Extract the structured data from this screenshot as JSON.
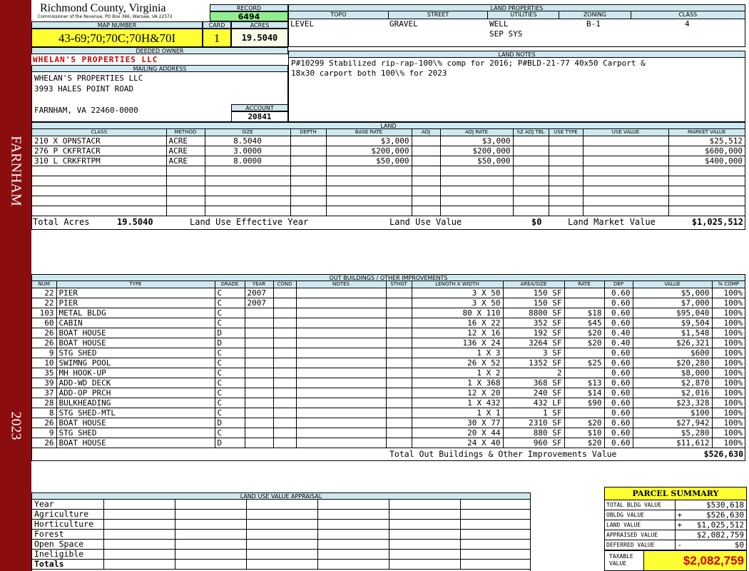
{
  "sidebar": {
    "city": "FARNHAM",
    "year": "2023"
  },
  "header": {
    "county": "Richmond County, Virginia",
    "commissioner": "Commissioner of the Revenue, PO Box 366, Warsaw, VA 22572",
    "record_label": "RECORD",
    "record": "6494",
    "map_number_label": "MAP NUMBER",
    "map_number": "43-69;70;70C;70H&70I",
    "card_label": "CARD",
    "card": "1",
    "acres_label": "ACRES",
    "acres": "19.5040"
  },
  "owner": {
    "deeded_owner_label": "DEEDED OWNER",
    "deeded_owner": "WHELAN'S PROPERTIES LLC",
    "mailing_address_label": "MAILING ADDRESS",
    "address_lines": [
      "WHELAN'S PROPERTIES LLC",
      "3993 HALES POINT ROAD",
      "",
      "FARNHAM, VA 22460-0000"
    ],
    "account_label": "ACCOUNT",
    "account": "20841"
  },
  "land_properties": {
    "label": "LAND PROPERTIES",
    "headers": [
      "TOPO",
      "STREET",
      "UTILITIES",
      "ZONING",
      "CLASS"
    ],
    "topo": "LEVEL",
    "street": "GRAVEL",
    "utilities": [
      "WELL",
      "SEP SYS"
    ],
    "zoning": "B-1",
    "class": "4"
  },
  "land_notes": {
    "label": "LAND NOTES",
    "lines": [
      "P#10299 Stabilized rip-rap-100\\% comp for 2016; P#BLD-21-77 40x50 Carport &",
      "18x30 carport both 100\\% for 2023"
    ]
  },
  "land": {
    "label": "LAND",
    "headers": [
      "CLASS",
      "METHOD",
      "SIZE",
      "DEPTH",
      "BASE RATE",
      "ADJ",
      "ADJ RATE",
      "SZ ADJ TBL",
      "USE TYPE",
      "USE VALUE",
      "MARKET VALUE"
    ],
    "rows": [
      {
        "class": "210 X OPNSTACR",
        "method": "ACRE",
        "size": "8.5040",
        "base_rate": "$3,000",
        "adj_rate": "$3,000",
        "market_value": "$25,512"
      },
      {
        "class": "276 P CKFRTACR",
        "method": "ACRE",
        "size": "3.0000",
        "base_rate": "$200,000",
        "adj_rate": "$200,000",
        "market_value": "$600,000"
      },
      {
        "class": "310 L CRKFRTPM",
        "method": "ACRE",
        "size": "8.0000",
        "base_rate": "$50,000",
        "adj_rate": "$50,000",
        "market_value": "$400,000"
      }
    ],
    "total_acres_label": "Total Acres",
    "total_acres": "19.5040",
    "effective_year_label": "Land Use Effective Year",
    "use_value_label": "Land Use Value",
    "use_value": "$0",
    "market_value_label": "Land Market Value",
    "market_value": "$1,025,512"
  },
  "outbuildings": {
    "label": "OUT BUILDINGS / OTHER IMPROVEMENTS",
    "headers": [
      "NUM",
      "TYPE",
      "GRADE",
      "YEAR",
      "COND",
      "NOTES",
      "STHGT",
      "LENGTH X WIDTH",
      "AREA/SIZE",
      "RATE",
      "DEP",
      "VALUE",
      "% COMP"
    ],
    "rows": [
      {
        "num": "22",
        "type": "PIER",
        "grade": "C",
        "year": "2007",
        "lw": "3 X 50",
        "area": "150 SF",
        "rate": "",
        "dep": "0.60",
        "value": "$5,000",
        "comp": "100%"
      },
      {
        "num": "22",
        "type": "PIER",
        "grade": "C",
        "year": "2007",
        "lw": "3 X 50",
        "area": "150 SF",
        "rate": "",
        "dep": "0.60",
        "value": "$7,000",
        "comp": "100%"
      },
      {
        "num": "103",
        "type": "METAL BLDG",
        "grade": "C",
        "year": "",
        "lw": "80 X 110",
        "area": "8800 SF",
        "rate": "$18",
        "dep": "0.60",
        "value": "$95,040",
        "comp": "100%"
      },
      {
        "num": "60",
        "type": "CABIN",
        "grade": "C",
        "year": "",
        "lw": "16 X 22",
        "area": "352 SF",
        "rate": "$45",
        "dep": "0.60",
        "value": "$9,504",
        "comp": "100%"
      },
      {
        "num": "26",
        "type": "BOAT HOUSE",
        "grade": "D",
        "year": "",
        "lw": "12 X 16",
        "area": "192 SF",
        "rate": "$20",
        "dep": "0.40",
        "value": "$1,548",
        "comp": "100%"
      },
      {
        "num": "26",
        "type": "BOAT HOUSE",
        "grade": "D",
        "year": "",
        "lw": "136 X 24",
        "area": "3264 SF",
        "rate": "$20",
        "dep": "0.40",
        "value": "$26,321",
        "comp": "100%"
      },
      {
        "num": "9",
        "type": "STG SHED",
        "grade": "C",
        "year": "",
        "lw": "1 X 3",
        "area": "3 SF",
        "rate": "",
        "dep": "0.60",
        "value": "$600",
        "comp": "100%"
      },
      {
        "num": "10",
        "type": "SWIMNG POOL",
        "grade": "C",
        "year": "",
        "lw": "26 X 52",
        "area": "1352 SF",
        "rate": "$25",
        "dep": "0.60",
        "value": "$20,280",
        "comp": "100%"
      },
      {
        "num": "35",
        "type": "MH HOOK-UP",
        "grade": "C",
        "year": "",
        "lw": "1 X 2",
        "area": "2",
        "rate": "",
        "dep": "0.60",
        "value": "$8,000",
        "comp": "100%"
      },
      {
        "num": "39",
        "type": "ADD-WD DECK",
        "grade": "C",
        "year": "",
        "lw": "1 X 368",
        "area": "368 SF",
        "rate": "$13",
        "dep": "0.60",
        "value": "$2,870",
        "comp": "100%"
      },
      {
        "num": "37",
        "type": "ADD-OP PRCH",
        "grade": "C",
        "year": "",
        "lw": "12 X 20",
        "area": "240 SF",
        "rate": "$14",
        "dep": "0.60",
        "value": "$2,016",
        "comp": "100%"
      },
      {
        "num": "28",
        "type": "BULKHEADING",
        "grade": "C",
        "year": "",
        "lw": "1 X 432",
        "area": "432 LF",
        "rate": "$90",
        "dep": "0.60",
        "value": "$23,328",
        "comp": "100%"
      },
      {
        "num": "8",
        "type": "STG SHED-MTL",
        "grade": "C",
        "year": "",
        "lw": "1 X 1",
        "area": "1 SF",
        "rate": "",
        "dep": "0.60",
        "value": "$100",
        "comp": "100%"
      },
      {
        "num": "26",
        "type": "BOAT HOUSE",
        "grade": "D",
        "year": "",
        "lw": "30 X 77",
        "area": "2310 SF",
        "rate": "$20",
        "dep": "0.60",
        "value": "$27,942",
        "comp": "100%"
      },
      {
        "num": "9",
        "type": "STG SHED",
        "grade": "C",
        "year": "",
        "lw": "20 X 44",
        "area": "880 SF",
        "rate": "$10",
        "dep": "0.60",
        "value": "$5,280",
        "comp": "100%"
      },
      {
        "num": "26",
        "type": "BOAT HOUSE",
        "grade": "D",
        "year": "",
        "lw": "24 X 40",
        "area": "960 SF",
        "rate": "$20",
        "dep": "0.60",
        "value": "$11,612",
        "comp": "100%"
      }
    ],
    "total_label": "Total Out Buildings & Other Improvements Value",
    "total": "$526,630"
  },
  "land_use_appraisal": {
    "label": "LAND USE VALUE APPRAISAL",
    "rows": [
      "Year",
      "Agriculture",
      "Horticulture",
      "Forest",
      "Open Space",
      "Ineligible",
      "Totals"
    ]
  },
  "parcel_summary": {
    "title": "PARCEL SUMMARY",
    "rows": [
      {
        "label": "TOTAL BLDG VALUE",
        "sign": "",
        "value": "$530,618"
      },
      {
        "label": "OBLDG VALUE",
        "sign": "+",
        "value": "$526,630"
      },
      {
        "label": "LAND VALUE",
        "sign": "+",
        "value": "$1,025,512"
      },
      {
        "label": "APPRAISED VALUE",
        "sign": "",
        "value": "$2,082,759"
      },
      {
        "label": "DEFERRED VALUE",
        "sign": "-",
        "value": "$0"
      }
    ],
    "taxable_label": "TAXABLE VALUE",
    "taxable": "$2,082,759"
  },
  "colors": {
    "sidebar": "#8b0d0d",
    "header_bg": "#cfe8ef",
    "record_bg": "#90ee90",
    "highlight": "#ffff33",
    "owner_red": "#d00000"
  }
}
